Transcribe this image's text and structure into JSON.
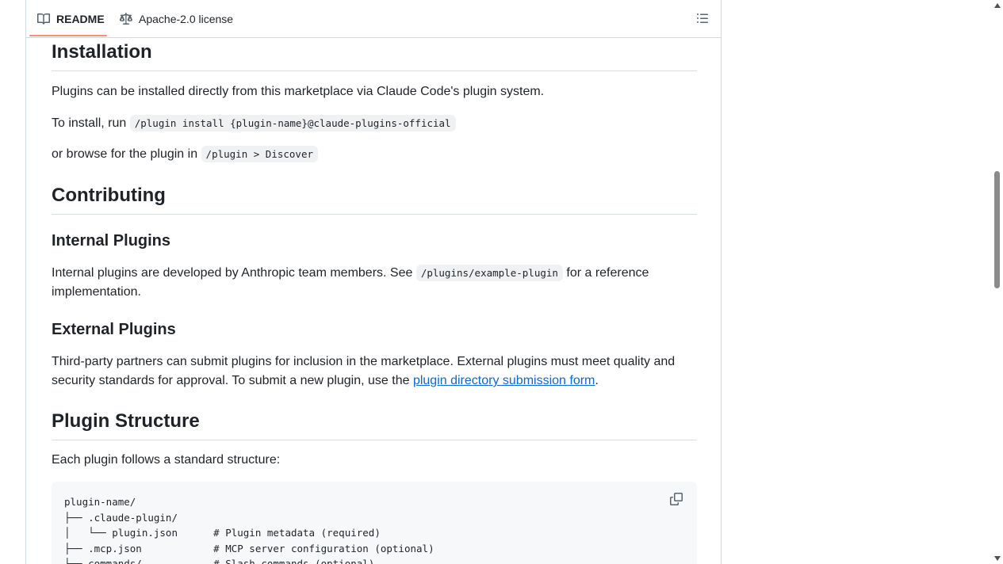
{
  "tabs": {
    "readme": {
      "label": "README",
      "icon": "book-icon"
    },
    "license": {
      "label": "Apache-2.0 license",
      "icon": "law-scale-icon"
    },
    "outline_icon": "list-unordered-icon"
  },
  "colors": {
    "active_tab_underline": "#fd8c73",
    "link": "#0969da",
    "code_bg": "#eff1f3",
    "codeblock_bg": "#f6f8fa"
  },
  "installation": {
    "heading": "Installation",
    "p1": "Plugins can be installed directly from this marketplace via Claude Code's plugin system.",
    "p2_pre": "To install, run ",
    "p2_code": "/plugin install {plugin-name}@claude-plugins-official",
    "p3_pre": "or browse for the plugin in ",
    "p3_code": "/plugin > Discover"
  },
  "contributing": {
    "heading": "Contributing",
    "internal": {
      "heading": "Internal Plugins",
      "pre": "Internal plugins are developed by Anthropic team members. See ",
      "code": "/plugins/example-plugin",
      "post": " for a reference implementation."
    },
    "external": {
      "heading": "External Plugins",
      "pre": "Third-party partners can submit plugins for inclusion in the marketplace. External plugins must meet quality and security standards for approval. To submit a new plugin, use the ",
      "link": "plugin directory submission form",
      "post": "."
    }
  },
  "structure": {
    "heading": "Plugin Structure",
    "intro": "Each plugin follows a standard structure:",
    "code": "plugin-name/\n├── .claude-plugin/\n│   └── plugin.json      # Plugin metadata (required)\n├── .mcp.json            # MCP server configuration (optional)\n├── commands/            # Slash commands (optional)",
    "copy_icon": "copy-icon"
  }
}
